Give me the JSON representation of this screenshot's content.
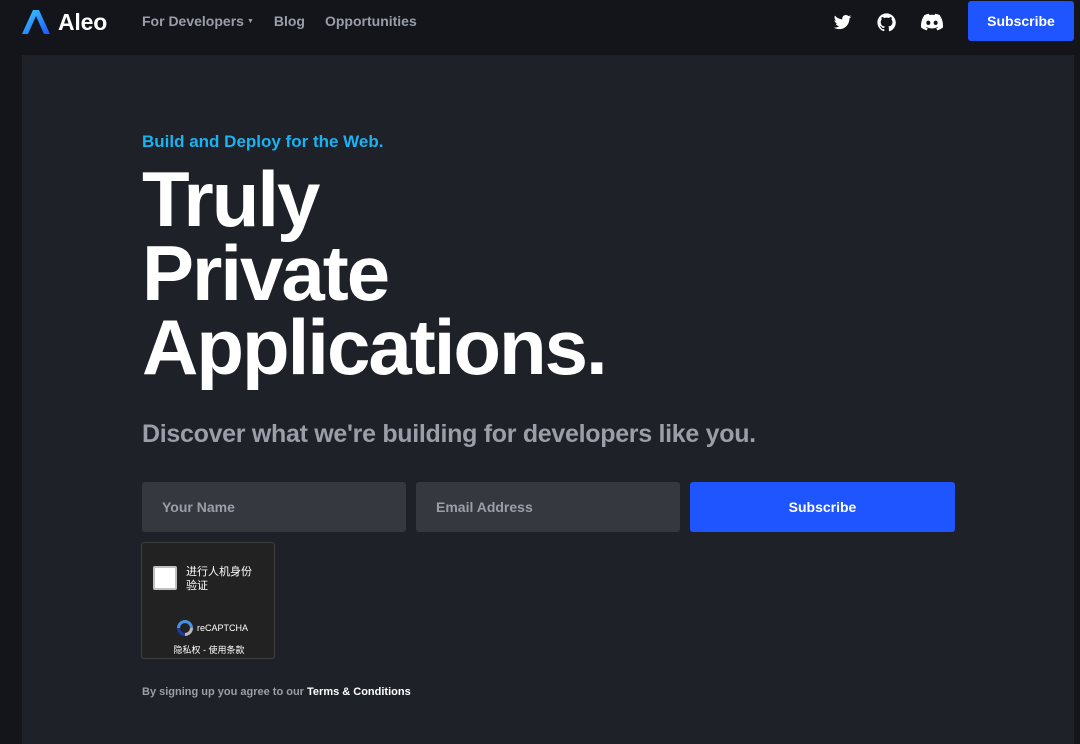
{
  "nav": {
    "brand": "Aleo",
    "links": [
      {
        "label": "For Developers",
        "caret": "▼"
      },
      {
        "label": "Blog"
      },
      {
        "label": "Opportunities"
      }
    ],
    "social": [
      "twitter-icon",
      "github-icon",
      "discord-icon"
    ],
    "subscribe_label": "Subscribe"
  },
  "hero": {
    "eyebrow": "Build and Deploy for the Web.",
    "headline": [
      "Truly",
      "Private",
      "Applications."
    ],
    "subhead": "Discover what we're building for developers like you."
  },
  "form": {
    "name_placeholder": "Your Name",
    "email_placeholder": "Email Address",
    "subscribe_label": "Subscribe"
  },
  "recaptcha": {
    "label_line1": "进行人机身份",
    "label_line2": "验证",
    "brand": "reCAPTCHA",
    "privacy": "隐私权",
    "separator": " - ",
    "terms": "使用条款"
  },
  "terms": {
    "prefix": "By signing up you agree to our ",
    "link": "Terms & Conditions"
  },
  "colors": {
    "accent": "#1f55ff",
    "eyebrow": "#1ab3f2",
    "panel": "#1f2128",
    "background": "#13151b"
  }
}
